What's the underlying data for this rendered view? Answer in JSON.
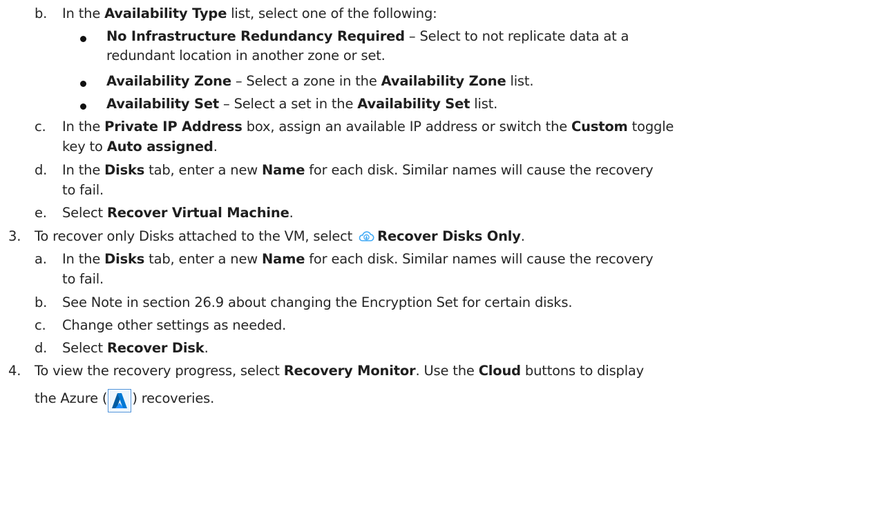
{
  "items": {
    "b1": {
      "marker": "b.",
      "p1": "In the ",
      "b1": "Availability Type",
      "p2": " list, select one of the following:"
    },
    "bullets": {
      "one": {
        "b1": "No Infrastructure Redundancy Required",
        "p1": " – Select to not replicate data at a",
        "cont": "redundant location in another zone or set."
      },
      "two": {
        "b1": "Availability Zone",
        "p1": " – Select a zone in the ",
        "b2": "Availability Zone",
        "p2": " list."
      },
      "three": {
        "b1": "Availability Set",
        "p1": " – Select a set in the ",
        "b2": "Availability Set",
        "p2": " list."
      }
    },
    "c1": {
      "marker": "c.",
      "p1": "In the ",
      "b1": "Private IP Address",
      "p2": " box, assign an available IP address or switch the ",
      "b2": "Custom",
      "p3": " toggle",
      "cont1": "key to ",
      "b3": "Auto assigned",
      "cont2": "."
    },
    "d1": {
      "marker": "d.",
      "p1": "In the ",
      "b1": "Disks",
      "p2": " tab, enter a new ",
      "b2": "Name",
      "p3": " for each disk. Similar names will cause the recovery",
      "cont": "to fail."
    },
    "e1": {
      "marker": "e.",
      "p1": "Select ",
      "b1": "Recover Virtual Machine",
      "p2": "."
    },
    "step3": {
      "marker": "3.",
      "p1": "To recover only Disks attached to the VM, select ",
      "icon": "cloud-download-icon",
      "b1": "Recover Disks Only",
      "p2": "."
    },
    "a3": {
      "marker": "a.",
      "p1": "In the ",
      "b1": "Disks",
      "p2": " tab, enter a new ",
      "b2": "Name",
      "p3": " for each disk. Similar names will cause the recovery",
      "cont": "to fail."
    },
    "b3": {
      "marker": "b.",
      "text": "See Note in section 26.9 about changing the Encryption Set for certain disks."
    },
    "c3": {
      "marker": "c.",
      "text": "Change other settings as needed."
    },
    "d3": {
      "marker": "d.",
      "p1": "Select ",
      "b1": "Recover Disk",
      "p2": "."
    },
    "step4": {
      "marker": "4.",
      "p1": "To view the recovery progress, select ",
      "b1": "Recovery Monitor",
      "p2": ". Use the ",
      "b2": "Cloud",
      "p3": " buttons to display",
      "cont1": "the Azure (",
      "icon": "azure-logo-icon",
      "cont2": ") recoveries."
    }
  },
  "colors": {
    "text": "#262626",
    "bold": "#1f1f1f",
    "cloud": "#3fa9f5",
    "azure": "#0078d4"
  }
}
